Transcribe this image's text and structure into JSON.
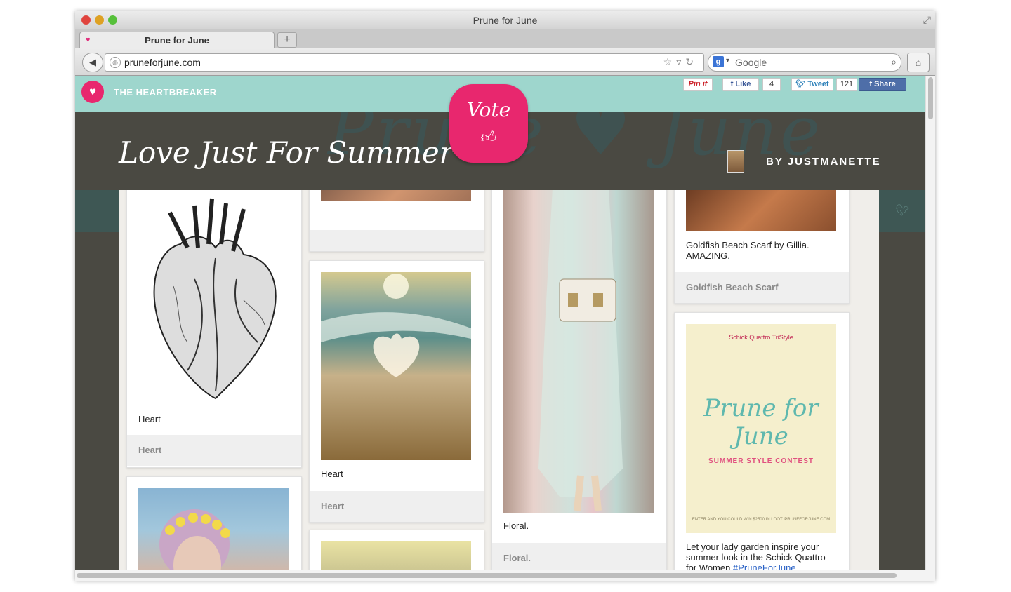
{
  "window": {
    "title": "Prune for June"
  },
  "tab": {
    "label": "Prune for June",
    "new_tab": "+"
  },
  "nav": {
    "url": "pruneforjune.com",
    "search_placeholder": "Google"
  },
  "topbar": {
    "section_label": "THE HEARTBREAKER",
    "pinit": "Pin it",
    "like": "Like",
    "like_count": "4",
    "tweet": "Tweet",
    "tweet_count": "121",
    "share": "Share"
  },
  "banner": {
    "title": "Love Just For Summer",
    "vote": "Vote",
    "byline": "BY JUSTMANETTE"
  },
  "cards": {
    "heart": {
      "caption": "Heart",
      "footer": "Heart"
    },
    "beach": {
      "caption": "Heart",
      "footer": "Heart"
    },
    "floral": {
      "caption": "Floral.",
      "footer": "Floral."
    },
    "scarf": {
      "caption": "Goldfish Beach Scarf by Gillia. AMAZING.",
      "footer": "Goldfish Beach Scarf"
    },
    "ad": {
      "brand": "Schick Quattro TriStyle",
      "script": "Prune for June",
      "contest": "SUMMER STYLE CONTEST",
      "fine": "ENTER AND YOU COULD WIN $2500 IN LOOT. PRUNEFORJUNE.COM",
      "caption": "Let your lady garden inspire your summer look in the Schick Quattro for Women",
      "hashtag": "#PruneForJune"
    }
  },
  "colors": {
    "accent_pink": "#e8276e",
    "mint": "#9ed6cd",
    "header_dark": "#4a4942"
  }
}
